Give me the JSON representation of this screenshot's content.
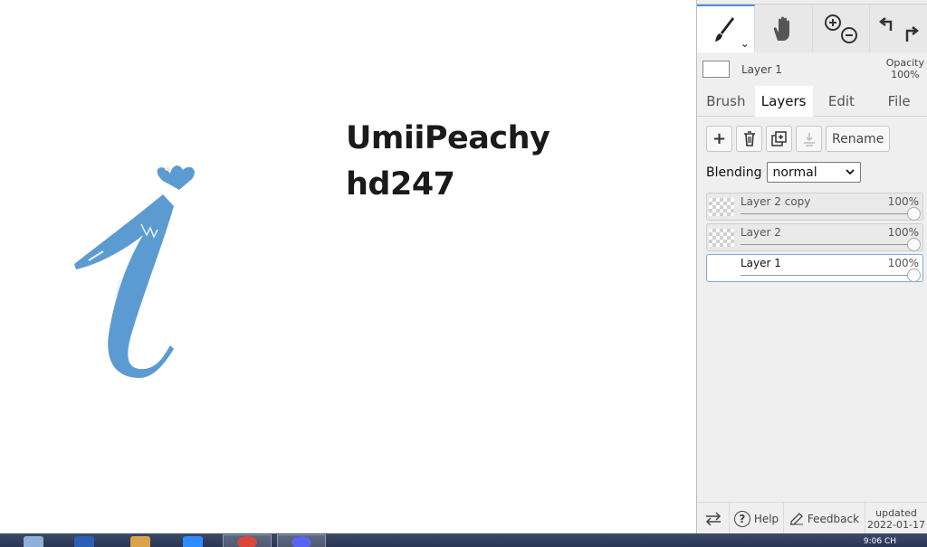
{
  "canvas": {
    "text_line1": "UmiiPeachy",
    "text_line2": "hd247",
    "drawing_color": "#5b9bd1"
  },
  "toolbar": {
    "tools": [
      {
        "name": "brush",
        "icon": "brush-icon",
        "active": true
      },
      {
        "name": "hand",
        "icon": "hand-icon"
      },
      {
        "name": "zoom",
        "icon": "zoom-icon"
      },
      {
        "name": "undo-redo",
        "icon": "undo-redo-icon"
      }
    ],
    "chevron": "⌄"
  },
  "current": {
    "layer_name": "Layer 1",
    "opacity_label": "Opacity",
    "opacity_value": "100%"
  },
  "tabs": [
    "Brush",
    "Layers",
    "Edit",
    "File"
  ],
  "layer_buttons": {
    "add": "+",
    "rename": "Rename"
  },
  "blending": {
    "label": "Blending",
    "value": "normal"
  },
  "layers": [
    {
      "name": "Layer 2 copy",
      "opacity": "100%",
      "selected": false
    },
    {
      "name": "Layer 2",
      "opacity": "100%",
      "selected": false
    },
    {
      "name": "Layer 1",
      "opacity": "100%",
      "selected": true
    }
  ],
  "footer": {
    "help": "Help",
    "feedback": "Feedback",
    "updated_label": "updated",
    "updated_date": "2022-01-17"
  },
  "taskbar": {
    "clock": "9:06 CH"
  },
  "colors": {
    "accent": "#4a90d9",
    "panel_bg": "#efefef"
  }
}
